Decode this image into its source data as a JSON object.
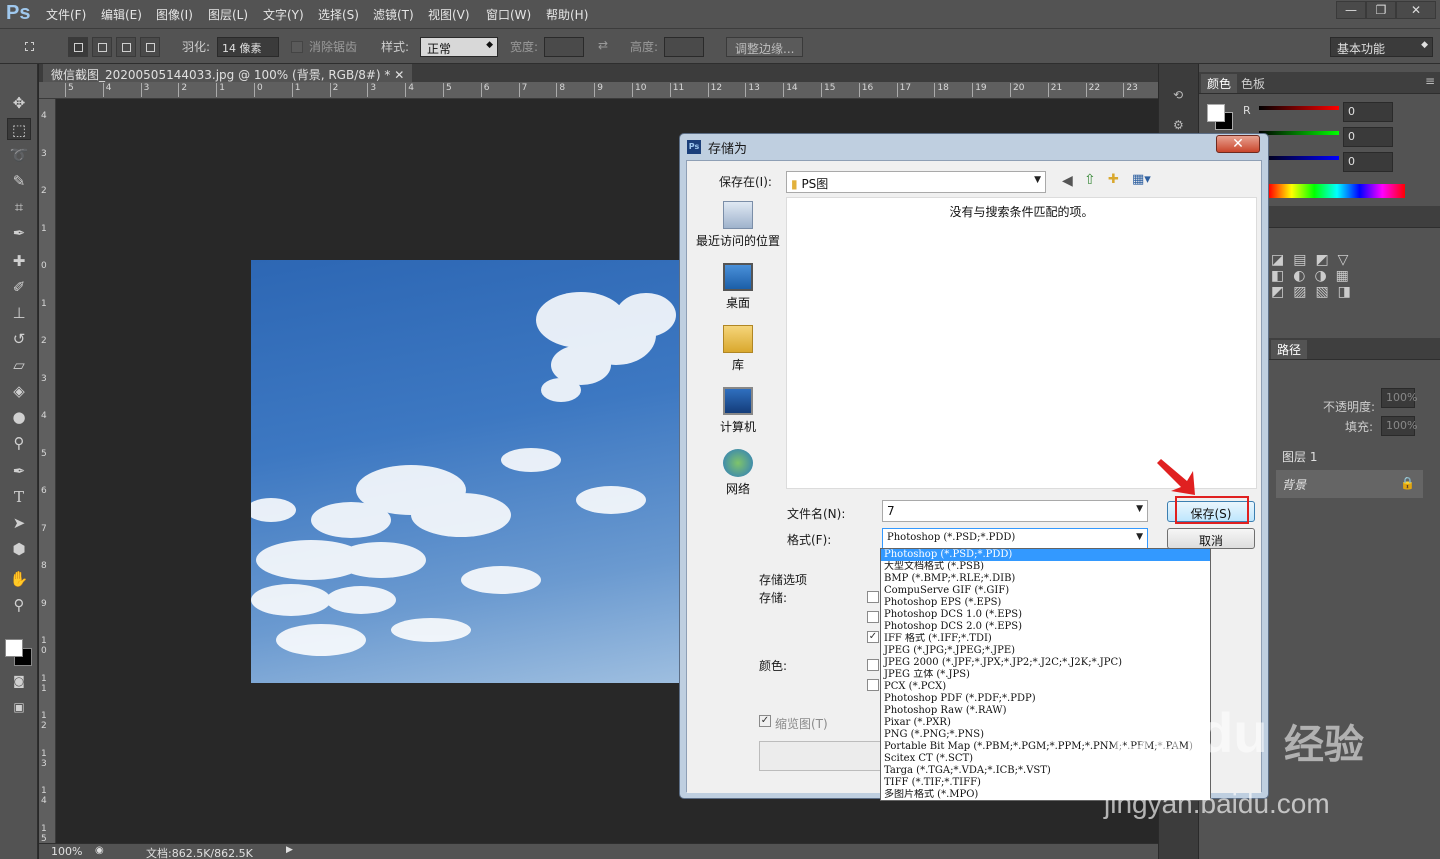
{
  "app": {
    "logo": "Ps"
  },
  "menu": [
    "文件(F)",
    "编辑(E)",
    "图像(I)",
    "图层(L)",
    "文字(Y)",
    "选择(S)",
    "滤镜(T)",
    "视图(V)",
    "窗口(W)",
    "帮助(H)"
  ],
  "window_controls": {
    "minimize": "—",
    "restore": "❐",
    "close": "✕"
  },
  "options": {
    "feather_label": "羽化:",
    "feather_value": "14 像素",
    "antialias_label": "消除锯齿",
    "style_label": "样式:",
    "style_value": "正常",
    "width_label": "宽度:",
    "height_label": "高度:",
    "refine_edge": "调整边缘...",
    "workspace": "基本功能"
  },
  "document": {
    "tab_title": "微信截图_20200505144033.jpg @ 100% (背景, RGB/8#) *",
    "zoom": "100%",
    "doc_size": "文档:862.5K/862.5K",
    "ruler_top": [
      "5",
      "4",
      "3",
      "2",
      "1",
      "0",
      "1",
      "2",
      "3",
      "4",
      "5",
      "6",
      "7",
      "8",
      "9",
      "10",
      "11",
      "12",
      "13",
      "14",
      "15",
      "16",
      "17",
      "18",
      "19",
      "20",
      "21",
      "22",
      "23"
    ],
    "ruler_left": [
      "4",
      "3",
      "2",
      "1",
      "0",
      "1",
      "2",
      "3",
      "4",
      "5",
      "6",
      "7",
      "8",
      "9",
      "1\n0",
      "1\n1",
      "1\n2",
      "1\n3",
      "1\n4",
      "1\n5"
    ]
  },
  "panels": {
    "color_tabs": [
      "颜色",
      "色板"
    ],
    "r_label": "R",
    "r_value": "0",
    "g_value": "0",
    "b_value": "0",
    "layers_tab": "路径",
    "opacity_label": "不透明度:",
    "opacity_value": "100%",
    "fill_label": "填充:",
    "fill_value": "100%",
    "layers": [
      "图层 1",
      "背景"
    ]
  },
  "dialog": {
    "title": "存储为",
    "save_in_label": "保存在(I):",
    "save_in_value": "PS图",
    "empty_message": "没有与搜索条件匹配的项。",
    "places": [
      "最近访问的位置",
      "桌面",
      "库",
      "计算机",
      "网络"
    ],
    "filename_label": "文件名(N):",
    "filename_value": "7",
    "format_label": "格式(F):",
    "format_value": "Photoshop (*.PSD;*.PDD)",
    "save_button": "保存(S)",
    "cancel_button": "取消",
    "save_options_label": "存储选项",
    "store_label": "存储:",
    "color_label": "颜色:",
    "thumbnail_label": "缩览图(T)",
    "format_options": [
      "Photoshop (*.PSD;*.PDD)",
      "大型文档格式 (*.PSB)",
      "BMP (*.BMP;*.RLE;*.DIB)",
      "CompuServe GIF (*.GIF)",
      "Photoshop EPS (*.EPS)",
      "Photoshop DCS 1.0 (*.EPS)",
      "Photoshop DCS 2.0 (*.EPS)",
      "IFF 格式 (*.IFF;*.TDI)",
      "JPEG (*.JPG;*.JPEG;*.JPE)",
      "JPEG 2000 (*.JPF;*.JPX;*.JP2;*.J2C;*.J2K;*.JPC)",
      "JPEG 立体 (*.JPS)",
      "PCX (*.PCX)",
      "Photoshop PDF (*.PDF;*.PDP)",
      "Photoshop Raw (*.RAW)",
      "Pixar (*.PXR)",
      "PNG (*.PNG;*.PNS)",
      "Portable Bit Map (*.PBM;*.PGM;*.PPM;*.PNM;*.PFM;*.PAM)",
      "Scitex CT (*.SCT)",
      "Targa (*.TGA;*.VDA;*.ICB;*.VST)",
      "TIFF (*.TIF;*.TIFF)",
      "多图片格式 (*.MPO)"
    ]
  },
  "watermark": {
    "brand": "Baidu",
    "product": "经验",
    "url": "jingyan.baidu.com"
  },
  "colors": {
    "ps_bg": "#535353",
    "canvas_bg": "#282828",
    "highlight": "#e02020",
    "dropdown_select": "#3399ff"
  }
}
